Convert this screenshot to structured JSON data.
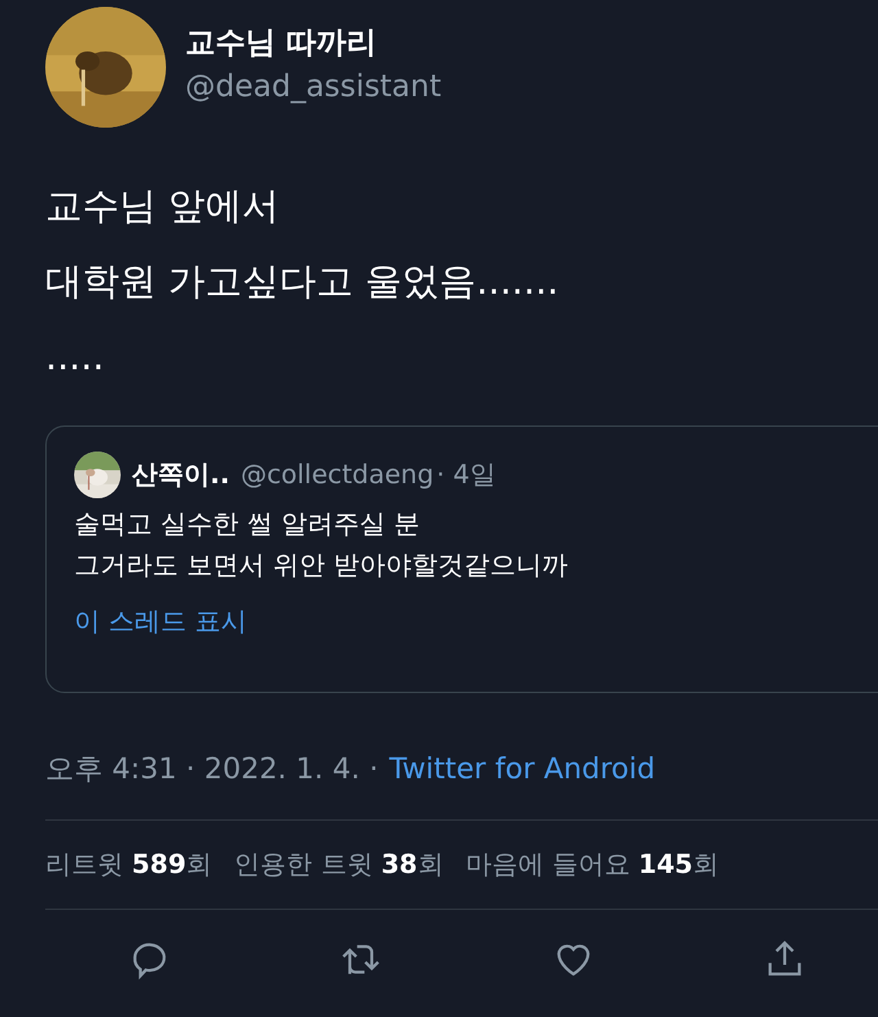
{
  "author": {
    "name": "교수님 따까리",
    "handle": "@dead_assistant",
    "avatar": {
      "kind": "picture"
    }
  },
  "body": [
    "교수님 앞에서",
    "대학원 가고싶다고 울었음.......",
    "....."
  ],
  "quote": {
    "name": "산쪽이..",
    "handle": "@collectdaeng",
    "age": "· 4일",
    "avatar": {
      "kind": "picture"
    },
    "lines": [
      "술먹고 실수한 썰 알려주실 분",
      "그거라도 보면서 위안 받아야할것같으니까"
    ],
    "link": "이 스레드 표시"
  },
  "meta": {
    "time": "오후 4:31 · 2022. 1. 4. ·",
    "source": "Twitter for Android"
  },
  "stats": [
    "리트윗 **589**회",
    "인용한 트윗 **38**회",
    "마음에 들어요 **145**회"
  ],
  "actions": [
    {
      "kind": "reply"
    },
    {
      "kind": "retweet"
    },
    {
      "kind": "like"
    },
    {
      "kind": "share"
    }
  ]
}
